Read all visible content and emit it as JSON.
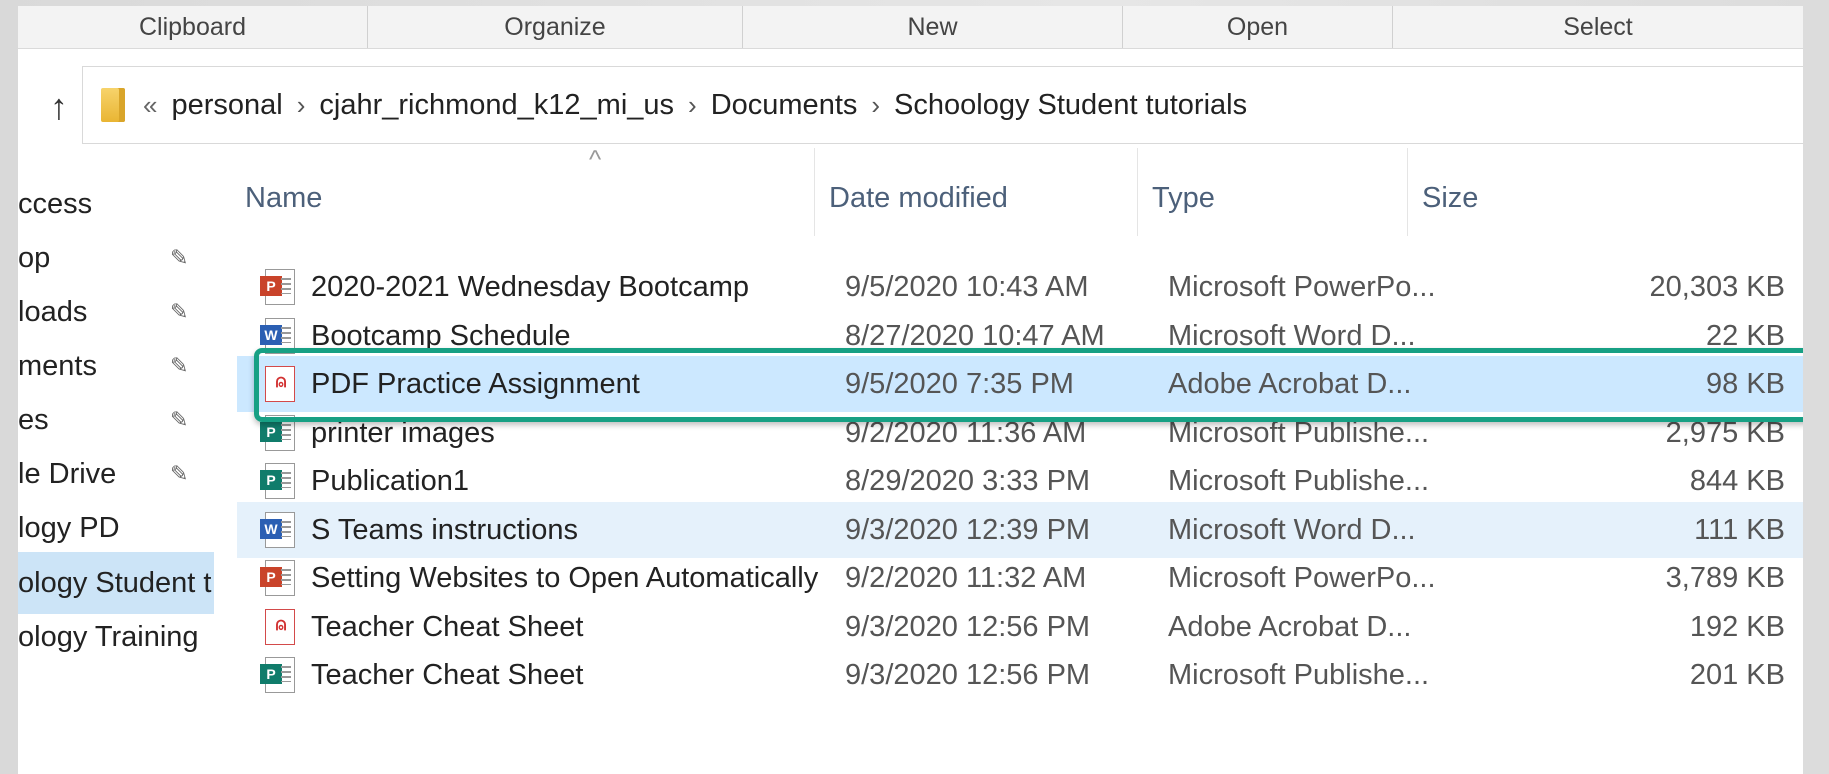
{
  "ribbon": {
    "groups": [
      "Clipboard",
      "Organize",
      "New",
      "Open",
      "Select"
    ]
  },
  "address_bar": {
    "overflow": "«",
    "crumbs": [
      "personal",
      "cjahr_richmond_k12_mi_us",
      "Documents",
      "Schoology Student tutorials"
    ],
    "separator": "›"
  },
  "nav": {
    "items": [
      {
        "label": "Quick access",
        "visible": "ccess",
        "pinned": false
      },
      {
        "label": "Desktop",
        "visible": "op",
        "pinned": true
      },
      {
        "label": "Downloads",
        "visible": "loads",
        "pinned": true
      },
      {
        "label": "Documents",
        "visible": "ments",
        "pinned": true
      },
      {
        "label": "Pictures",
        "visible": "es",
        "pinned": true
      },
      {
        "label": "Google Drive",
        "visible": "le Drive",
        "pinned": true
      },
      {
        "label": "Schoology PD",
        "visible": "logy PD",
        "pinned": false
      },
      {
        "label": "Schoology Student tutorials",
        "visible": "ology Student t",
        "pinned": false,
        "selected": true
      },
      {
        "label": "Schoology Training",
        "visible": "ology Training",
        "pinned": false
      }
    ],
    "pin_glyph": "📌"
  },
  "columns": {
    "name": "Name",
    "date": "Date modified",
    "type": "Type",
    "size": "Size",
    "sort_caret": "^"
  },
  "files": [
    {
      "name": "2020-2021 Wednesday Bootcamp",
      "date": "9/5/2020 10:43 AM",
      "type": "Microsoft PowerPo...",
      "size": "20,303 KB",
      "icon": "ppt-icon",
      "badge": "P"
    },
    {
      "name": "Bootcamp Schedule",
      "date": "8/27/2020 10:47 AM",
      "type": "Microsoft Word D...",
      "size": "22 KB",
      "icon": "word-icon",
      "badge": "W"
    },
    {
      "name": "PDF Practice Assignment",
      "date": "9/5/2020 7:35 PM",
      "type": "Adobe Acrobat D...",
      "size": "98 KB",
      "icon": "pdf-icon",
      "badge": "⍝"
    },
    {
      "name": "printer images",
      "date": "9/2/2020 11:36 AM",
      "type": "Microsoft Publishe...",
      "size": "2,975 KB",
      "icon": "publisher-icon",
      "badge": "P"
    },
    {
      "name": "Publication1",
      "date": "8/29/2020 3:33 PM",
      "type": "Microsoft Publishe...",
      "size": "844 KB",
      "icon": "publisher-icon",
      "badge": "P"
    },
    {
      "name": "S Teams instructions",
      "date": "9/3/2020 12:39 PM",
      "type": "Microsoft Word D...",
      "size": "111 KB",
      "icon": "word-icon",
      "badge": "W"
    },
    {
      "name": "Setting Websites to Open Automatically",
      "date": "9/2/2020 11:32 AM",
      "type": "Microsoft PowerPo...",
      "size": "3,789 KB",
      "icon": "ppt-icon",
      "badge": "P"
    },
    {
      "name": "Teacher Cheat Sheet",
      "date": "9/3/2020 12:56 PM",
      "type": "Adobe Acrobat D...",
      "size": "192 KB",
      "icon": "pdf-icon",
      "badge": "⍝"
    },
    {
      "name": "Teacher Cheat Sheet",
      "date": "9/3/2020 12:56 PM",
      "type": "Microsoft Publishe...",
      "size": "201 KB",
      "icon": "publisher-icon",
      "badge": "P"
    }
  ],
  "selection": {
    "selected_index": 2,
    "hover_index": 5
  },
  "colors": {
    "selected_row": "#cce8ff",
    "hover_row": "#e5f1fb",
    "outline": "#17a084"
  }
}
